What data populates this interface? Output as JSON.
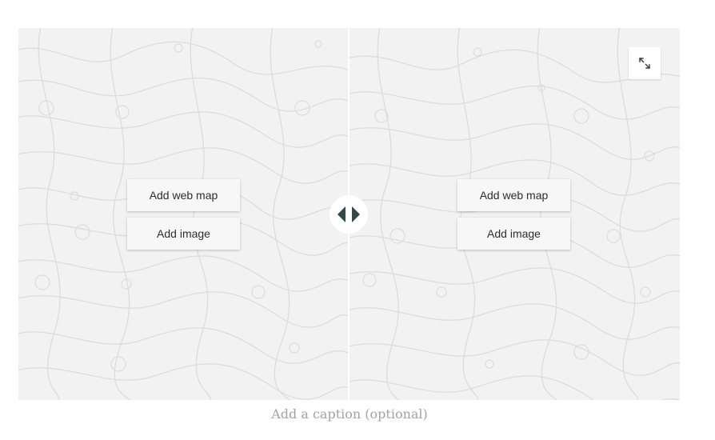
{
  "left_pane": {
    "add_web_map_label": "Add web map",
    "add_image_label": "Add image"
  },
  "right_pane": {
    "add_web_map_label": "Add web map",
    "add_image_label": "Add image",
    "expand_icon": "expand-icon"
  },
  "swipe_handle": {
    "icon": "left-right-arrows-icon"
  },
  "caption": {
    "placeholder": "Add a caption (optional)"
  },
  "colors": {
    "pane_background": "#f2f2f2",
    "topo_lines": "#dcdcdc",
    "handle_arrows": "#2f4a48",
    "caption_text": "#a3a3a3"
  }
}
